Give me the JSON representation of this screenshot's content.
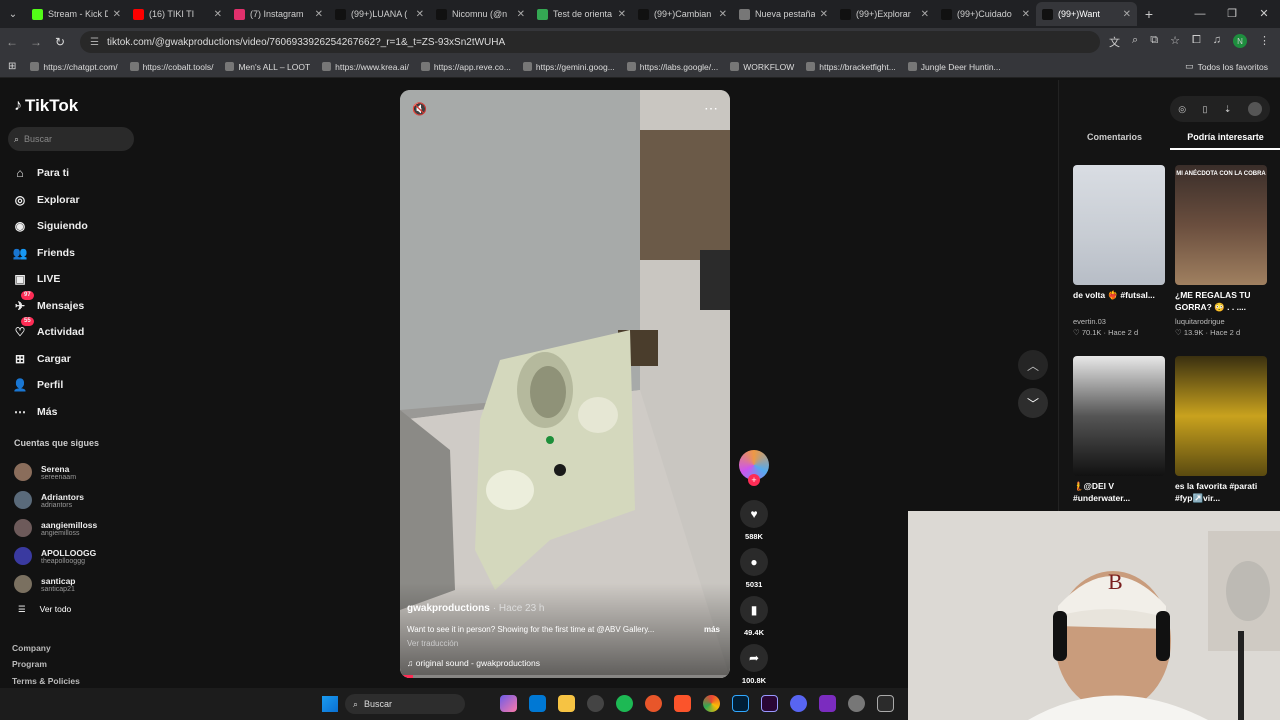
{
  "browser": {
    "tabs": [
      {
        "title": "Stream - Kick D",
        "color": "#53fc18"
      },
      {
        "title": "(16) TIKI TI",
        "color": "#ff0000"
      },
      {
        "title": "(7) Instagram",
        "color": "#e1306c"
      },
      {
        "title": "(99+)LUANA (",
        "color": "#111111"
      },
      {
        "title": "Nicomnu (@n",
        "color": "#111111"
      },
      {
        "title": "Test de orienta",
        "color": "#34a853"
      },
      {
        "title": "(99+)Cambian",
        "color": "#111111"
      },
      {
        "title": "Nueva pestaña",
        "color": "#777777"
      },
      {
        "title": "(99+)Explorar",
        "color": "#111111"
      },
      {
        "title": "(99+)Cuidado",
        "color": "#111111"
      },
      {
        "title": "(99+)Want",
        "color": "#111111"
      }
    ],
    "url": "tiktok.com/@gwakproductions/video/7606933926254267662?_r=1&_t=ZS-93xSn2tWUHA",
    "profile_initial": "N",
    "bookmarks": [
      "https://chatgpt.com/",
      "https://cobalt.tools/",
      "Men's ALL – LOOT",
      "https://www.krea.ai/",
      "https://app.reve.co...",
      "https://gemini.goog...",
      "https://labs.google/...",
      "WORKFLOW",
      "https://bracketfight...",
      "Jungle Deer Huntin..."
    ],
    "bookmarks_folder": "Todos los favoritos"
  },
  "sidebar": {
    "logo": "TikTok",
    "search_placeholder": "Buscar",
    "nav": [
      {
        "label": "Para ti",
        "icon": "home-icon"
      },
      {
        "label": "Explorar",
        "icon": "compass-icon"
      },
      {
        "label": "Siguiendo",
        "icon": "following-icon"
      },
      {
        "label": "Friends",
        "icon": "friends-icon"
      },
      {
        "label": "LIVE",
        "icon": "live-icon"
      },
      {
        "label": "Mensajes",
        "icon": "messages-icon",
        "badge": "97"
      },
      {
        "label": "Actividad",
        "icon": "activity-icon",
        "badge": "55"
      },
      {
        "label": "Cargar",
        "icon": "upload-icon"
      },
      {
        "label": "Perfil",
        "icon": "profile-icon"
      },
      {
        "label": "Más",
        "icon": "more-icon"
      }
    ],
    "following_title": "Cuentas que sigues",
    "following": [
      {
        "name": "Serena",
        "handle": "sereenaam"
      },
      {
        "name": "Adriantors",
        "handle": "adriantors"
      },
      {
        "name": "aangiemilloss",
        "handle": "angiemilloss"
      },
      {
        "name": "APOLLOOGG",
        "handle": "theapollooggg"
      },
      {
        "name": "santicap",
        "handle": "santicap21"
      }
    ],
    "see_all": "Ver todo",
    "footer": [
      "Company",
      "Program",
      "Terms & Policies"
    ]
  },
  "video": {
    "username": "gwakproductions",
    "age": "· Hace 23 h",
    "description": "Want to see it in person? Showing for the first time at @ABV Gallery...",
    "more": "más",
    "translate": "Ver traducción",
    "sound": "original sound - gwakproductions",
    "progress": 0.04
  },
  "actions": {
    "likes": "588K",
    "comments": "5031",
    "saves": "49.4K",
    "shares": "100.8K"
  },
  "right_panel": {
    "tabs": [
      "Comentarios",
      "Podría interesarte"
    ],
    "active_tab": 1,
    "cards": [
      {
        "title": "de volta ❤️‍🔥 #futsal...",
        "user": "evertin.03",
        "likes": "70.1K",
        "age": "Hace 2 d"
      },
      {
        "title": "¿ME REGALAS TU GORRA? 😳 . . ....",
        "user": "luquitarodrigue",
        "likes": "13.9K",
        "age": "Hace 2 d"
      },
      {
        "title": "🧜@DEI V #underwater...",
        "user": "",
        "likes": "",
        "age": ""
      },
      {
        "title": "es la favorita #parati #fyp↗️vir...",
        "user": "",
        "likes": "",
        "age": ""
      }
    ],
    "card_overlay_text": "MI ANÉCDOTA CON LA COBRA"
  },
  "taskbar": {
    "search_placeholder": "Buscar"
  }
}
